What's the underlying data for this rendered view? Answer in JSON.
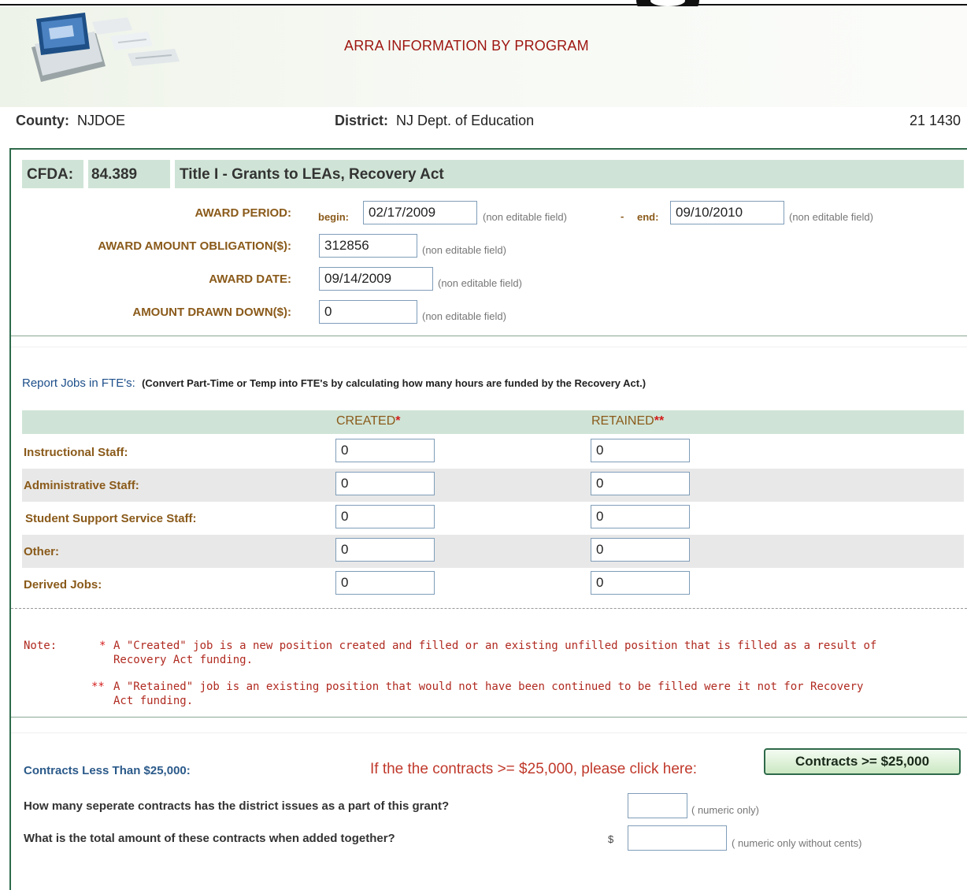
{
  "header": {
    "title": "ARRA INFORMATION BY PROGRAM"
  },
  "location": {
    "county_label": "County:",
    "county_value": "NJDOE",
    "district_label": "District:",
    "district_value": "NJ Dept. of Education",
    "code": "21 1430"
  },
  "cfda": {
    "label": "CFDA:",
    "number": "84.389",
    "program": "Title I - Grants to LEAs, Recovery Act"
  },
  "award": {
    "period_label": "AWARD PERIOD:",
    "begin_label": "begin:",
    "begin_value": "02/17/2009",
    "dash": "-",
    "end_label": "end:",
    "end_value": "09/10/2010",
    "obligation_label": "AWARD AMOUNT OBLIGATION($):",
    "obligation_value": "312856",
    "date_label": "AWARD DATE:",
    "date_value": "09/14/2009",
    "drawn_label": "AMOUNT DRAWN DOWN($):",
    "drawn_value": "0",
    "non_editable": "(non editable field)"
  },
  "jobs": {
    "title": "Report Jobs in FTE's:",
    "instruction": "(Convert Part-Time or Temp into FTE's by calculating how many hours are funded by the Recovery Act.)",
    "created_header": "CREATED",
    "created_mark": "*",
    "retained_header": "RETAINED",
    "retained_mark": "**",
    "rows": [
      {
        "label": "Instructional Staff:",
        "created": "0",
        "retained": "0"
      },
      {
        "label": "Administrative Staff:",
        "created": "0",
        "retained": "0"
      },
      {
        "label": "Student Support Service Staff:",
        "created": "0",
        "retained": "0"
      },
      {
        "label": "Other:",
        "created": "0",
        "retained": "0"
      },
      {
        "label": "Derived Jobs:",
        "created": "0",
        "retained": "0"
      }
    ]
  },
  "notes": {
    "label": "Note:",
    "created_mark": "*",
    "created_line1": "A \"Created\" job is a new position created and filled or an existing unfilled position that is filled as a result of",
    "created_line2": "Recovery Act funding.",
    "retained_mark": "**",
    "retained_line1": "A \"Retained\" job is an existing position that would not have been continued to be filled were it not for Recovery",
    "retained_line2": "Act funding."
  },
  "contracts": {
    "label": "Contracts Less Than $25,000:",
    "click_text": "If the the contracts >= $25,000, please click here:",
    "button_label": "Contracts >= $25,000",
    "q1": "How many seperate contracts has the district issues as a part of this grant?",
    "q1_hint": "( numeric only)",
    "q1_value": "",
    "q2": "What is the total amount of these contracts when added together?",
    "q2_prefix": "$",
    "q2_hint": "( numeric only without cents)",
    "q2_value": ""
  }
}
